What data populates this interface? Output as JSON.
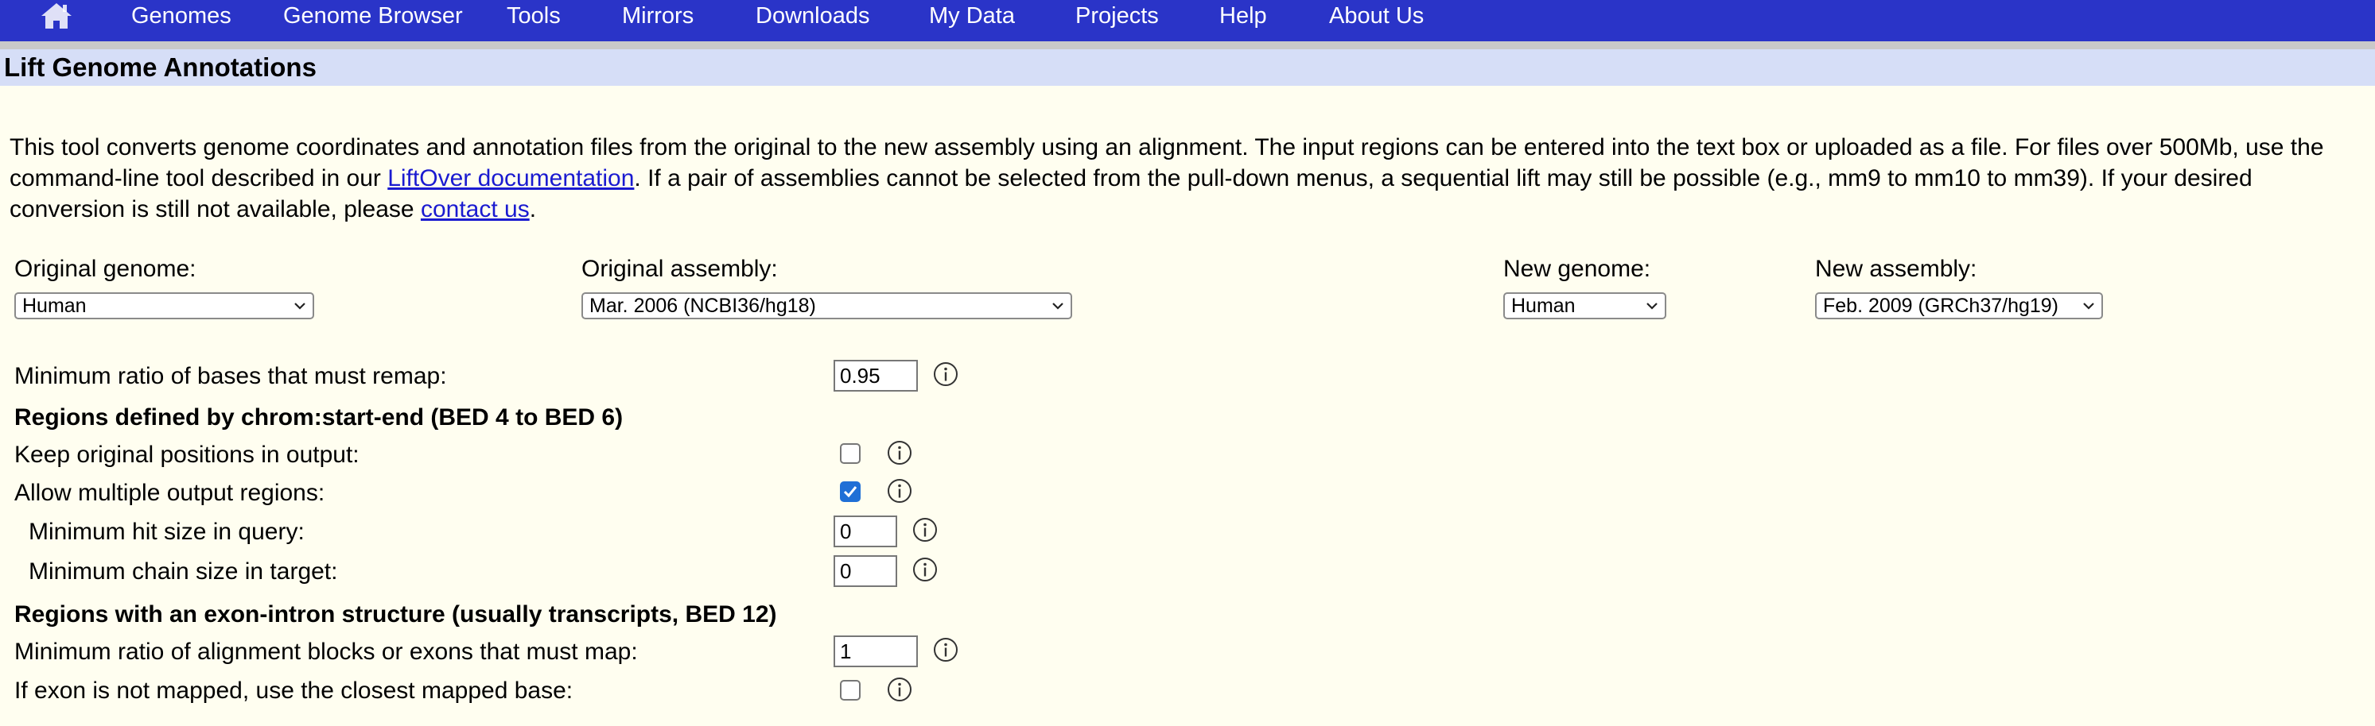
{
  "nav": {
    "items": [
      "Genomes",
      "Genome Browser",
      "Tools",
      "Mirrors",
      "Downloads",
      "My Data",
      "Projects",
      "Help",
      "About Us"
    ]
  },
  "page_title": "Lift Genome Annotations",
  "intro": {
    "text_before_link1": "This tool converts genome coordinates and annotation files from the original to the new assembly using an alignment.  The input regions can be entered into the text box or uploaded as a file.  For files over 500Mb, use the command-line tool described in our ",
    "link1": "LiftOver documentation",
    "text_between": ".  If a pair of assemblies cannot be selected from the pull-down menus, a sequential lift may still be possible (e.g., mm9 to mm10 to mm39).  If your desired conversion is still not available, please ",
    "link2": "contact us",
    "text_after": "."
  },
  "selectors": {
    "original_genome": {
      "label": "Original genome:",
      "value": "Human"
    },
    "original_assembly": {
      "label": "Original assembly:",
      "value": "Mar. 2006 (NCBI36/hg18)"
    },
    "new_genome": {
      "label": "New genome:",
      "value": "Human"
    },
    "new_assembly": {
      "label": "New assembly:",
      "value": "Feb. 2009 (GRCh37/hg19)"
    }
  },
  "options": {
    "min_ratio": {
      "label": "Minimum ratio of bases that must remap:",
      "value": "0.95"
    },
    "bed_section": "Regions defined by chrom:start-end (BED 4 to BED 6)",
    "keep_original": {
      "label": "Keep original positions in output:",
      "checked": false
    },
    "allow_multiple": {
      "label": "Allow multiple output regions:",
      "checked": true
    },
    "min_hit": {
      "label": "Minimum hit size in query:",
      "value": "0"
    },
    "min_chain": {
      "label": "Minimum chain size in target:",
      "value": "0"
    },
    "exon_section": "Regions with an exon-intron structure (usually transcripts, BED 12)",
    "min_blocks": {
      "label": "Minimum ratio of alignment blocks or exons that must map:",
      "value": "1"
    },
    "exon_closest": {
      "label": "If exon is not mapped, use the closest mapped base:",
      "checked": false
    }
  },
  "colors": {
    "nav_bg": "#2a34c8",
    "title_bg": "#d6def7",
    "page_bg": "#fffef0",
    "link": "#1a1ad0",
    "checkbox_checked": "#1f6fd6"
  },
  "icons": [
    "home-icon",
    "chevron-down-icon",
    "info-icon"
  ]
}
